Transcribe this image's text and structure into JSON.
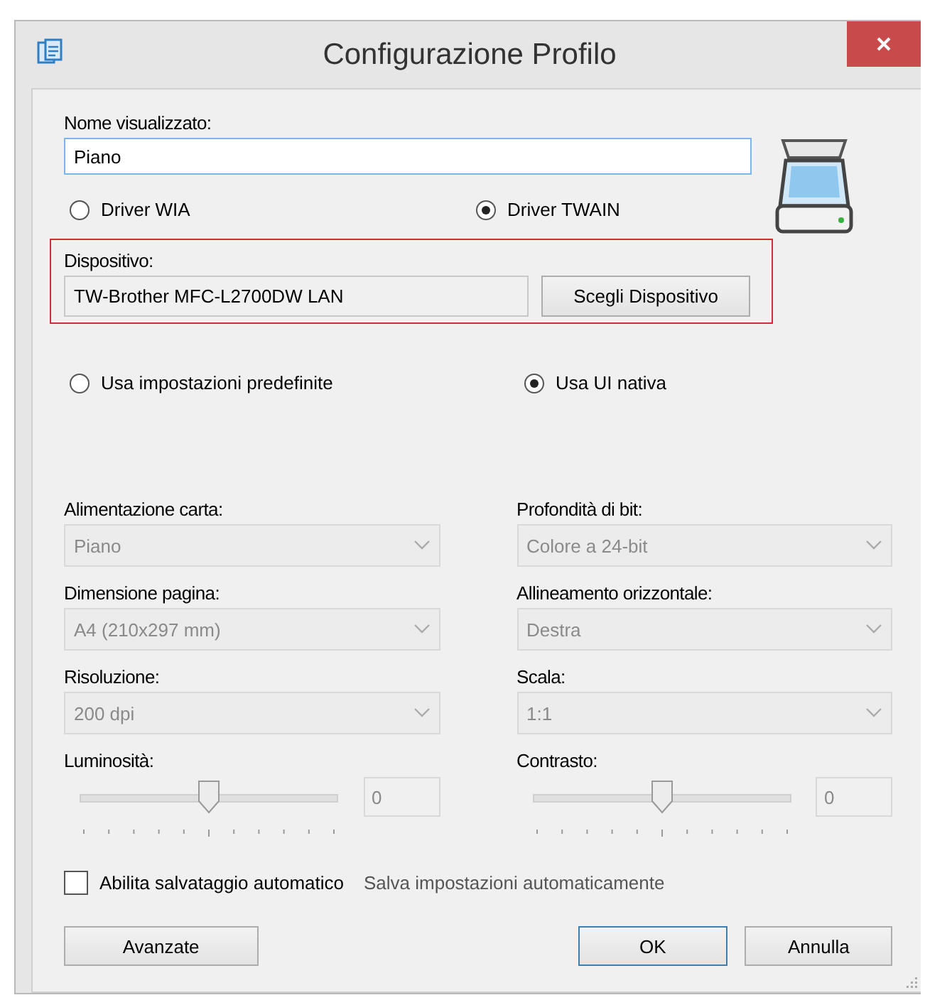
{
  "window": {
    "title": "Configurazione Profilo"
  },
  "display_name": {
    "label": "Nome visualizzato:",
    "value": "Piano"
  },
  "driver_options": [
    {
      "label": "Driver WIA",
      "selected": false
    },
    {
      "label": "Driver TWAIN",
      "selected": true
    }
  ],
  "device": {
    "label": "Dispositivo:",
    "value": "TW-Brother MFC-L2700DW LAN",
    "button": "Scegli Dispositivo"
  },
  "settings_mode": [
    {
      "label": "Usa impostazioni predefinite",
      "selected": false
    },
    {
      "label": "Usa UI nativa",
      "selected": true
    }
  ],
  "left_column": [
    {
      "kind": "dropdown",
      "label": "Alimentazione carta:",
      "value": "Piano",
      "disabled": true
    },
    {
      "kind": "dropdown",
      "label": "Dimensione pagina:",
      "value": "A4 (210x297 mm)",
      "disabled": true
    },
    {
      "kind": "dropdown",
      "label": "Risoluzione:",
      "value": "200 dpi",
      "disabled": true
    },
    {
      "kind": "slider",
      "label": "Luminosità:",
      "level": 0.5,
      "value": "0",
      "disabled": true
    }
  ],
  "right_column": [
    {
      "kind": "dropdown",
      "label": "Profondità di bit:",
      "value": "Colore a 24-bit",
      "disabled": true
    },
    {
      "kind": "dropdown",
      "label": "Allineamento orizzontale:",
      "value": "Destra",
      "disabled": true
    },
    {
      "kind": "dropdown",
      "label": "Scala:",
      "value": "1:1",
      "disabled": true
    },
    {
      "kind": "slider",
      "label": "Contrasto:",
      "level": 0.5,
      "value": "0",
      "disabled": true
    }
  ],
  "autosave": {
    "label": "Abilita salvataggio automatico",
    "checked": false,
    "hint": "Salva impostazioni automaticamente"
  },
  "buttons": [
    {
      "label": "Avanzate",
      "default": false
    },
    {
      "label": "OK",
      "default": true
    },
    {
      "label": "Annulla",
      "default": false
    }
  ]
}
